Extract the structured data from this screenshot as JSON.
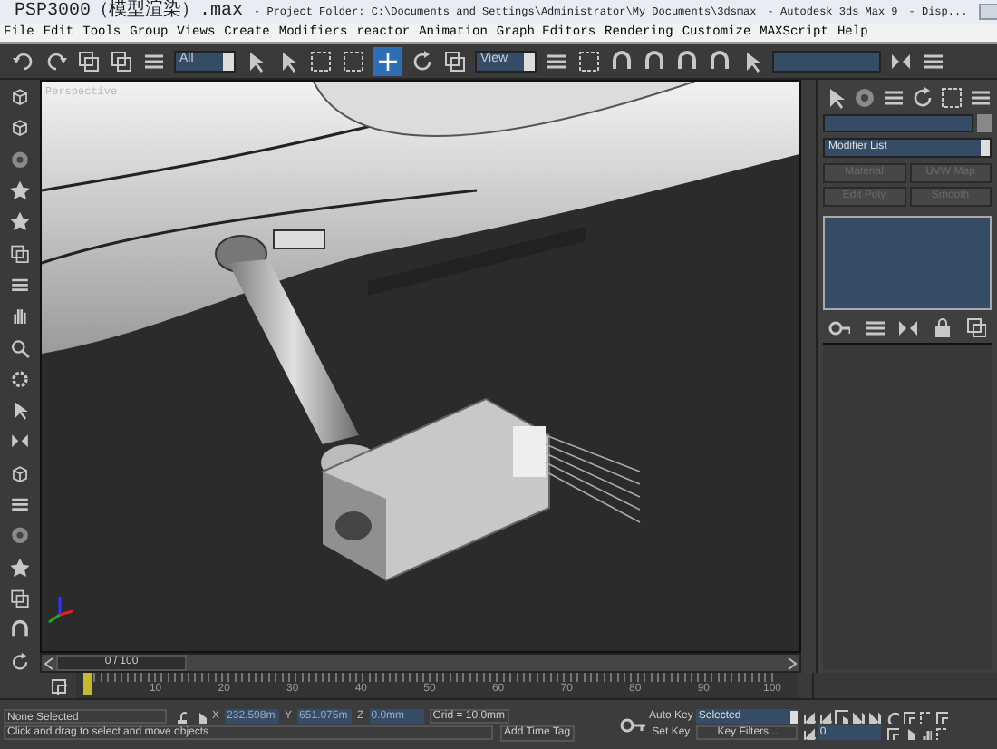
{
  "window": {
    "title_file": "PSP3000（模型渲染）.max",
    "title_project": "- Project Folder: C:\\Documents and Settings\\Administrator\\My Documents\\3dsmax",
    "title_app": "- Autodesk 3ds Max 9",
    "title_rest": "- Disp..."
  },
  "menu": [
    "File",
    "Edit",
    "Tools",
    "Group",
    "Views",
    "Create",
    "Modifiers",
    "reactor",
    "Animation",
    "Graph Editors",
    "Rendering",
    "Customize",
    "MAXScript",
    "Help"
  ],
  "toolbar": {
    "selection_filter": "All",
    "reference_coord": "View",
    "move_tool": {
      "selected": true
    }
  },
  "viewport": {
    "label": "Perspective"
  },
  "command_panel": {
    "modifier_list": "Modifier List",
    "buttons": [
      {
        "label": "Material",
        "disabled": true
      },
      {
        "label": "UVW Map",
        "disabled": true
      },
      {
        "label": "Edit Poly",
        "disabled": true
      },
      {
        "label": "Smooth",
        "disabled": true
      }
    ]
  },
  "time_slider": {
    "label": "0 / 100",
    "level": 0
  },
  "trackbar": {
    "labels": [
      "10",
      "20",
      "30",
      "40",
      "50",
      "60",
      "70",
      "80",
      "90",
      "100"
    ]
  },
  "status_bar": {
    "selection": "None Selected",
    "x_label": "X",
    "x": "232.598m",
    "y_label": "Y",
    "z_label": "Z",
    "y": "651.075m",
    "z": "0.0mm",
    "grid": "Grid = 10.0mm",
    "prompt": "Click and drag to select and move objects",
    "add_time_tag": "Add Time Tag",
    "auto_key": "Auto Key",
    "key_mode": "Selected",
    "set_key": "Set Key",
    "key_filters": "Key Filters...",
    "frame": "0"
  }
}
